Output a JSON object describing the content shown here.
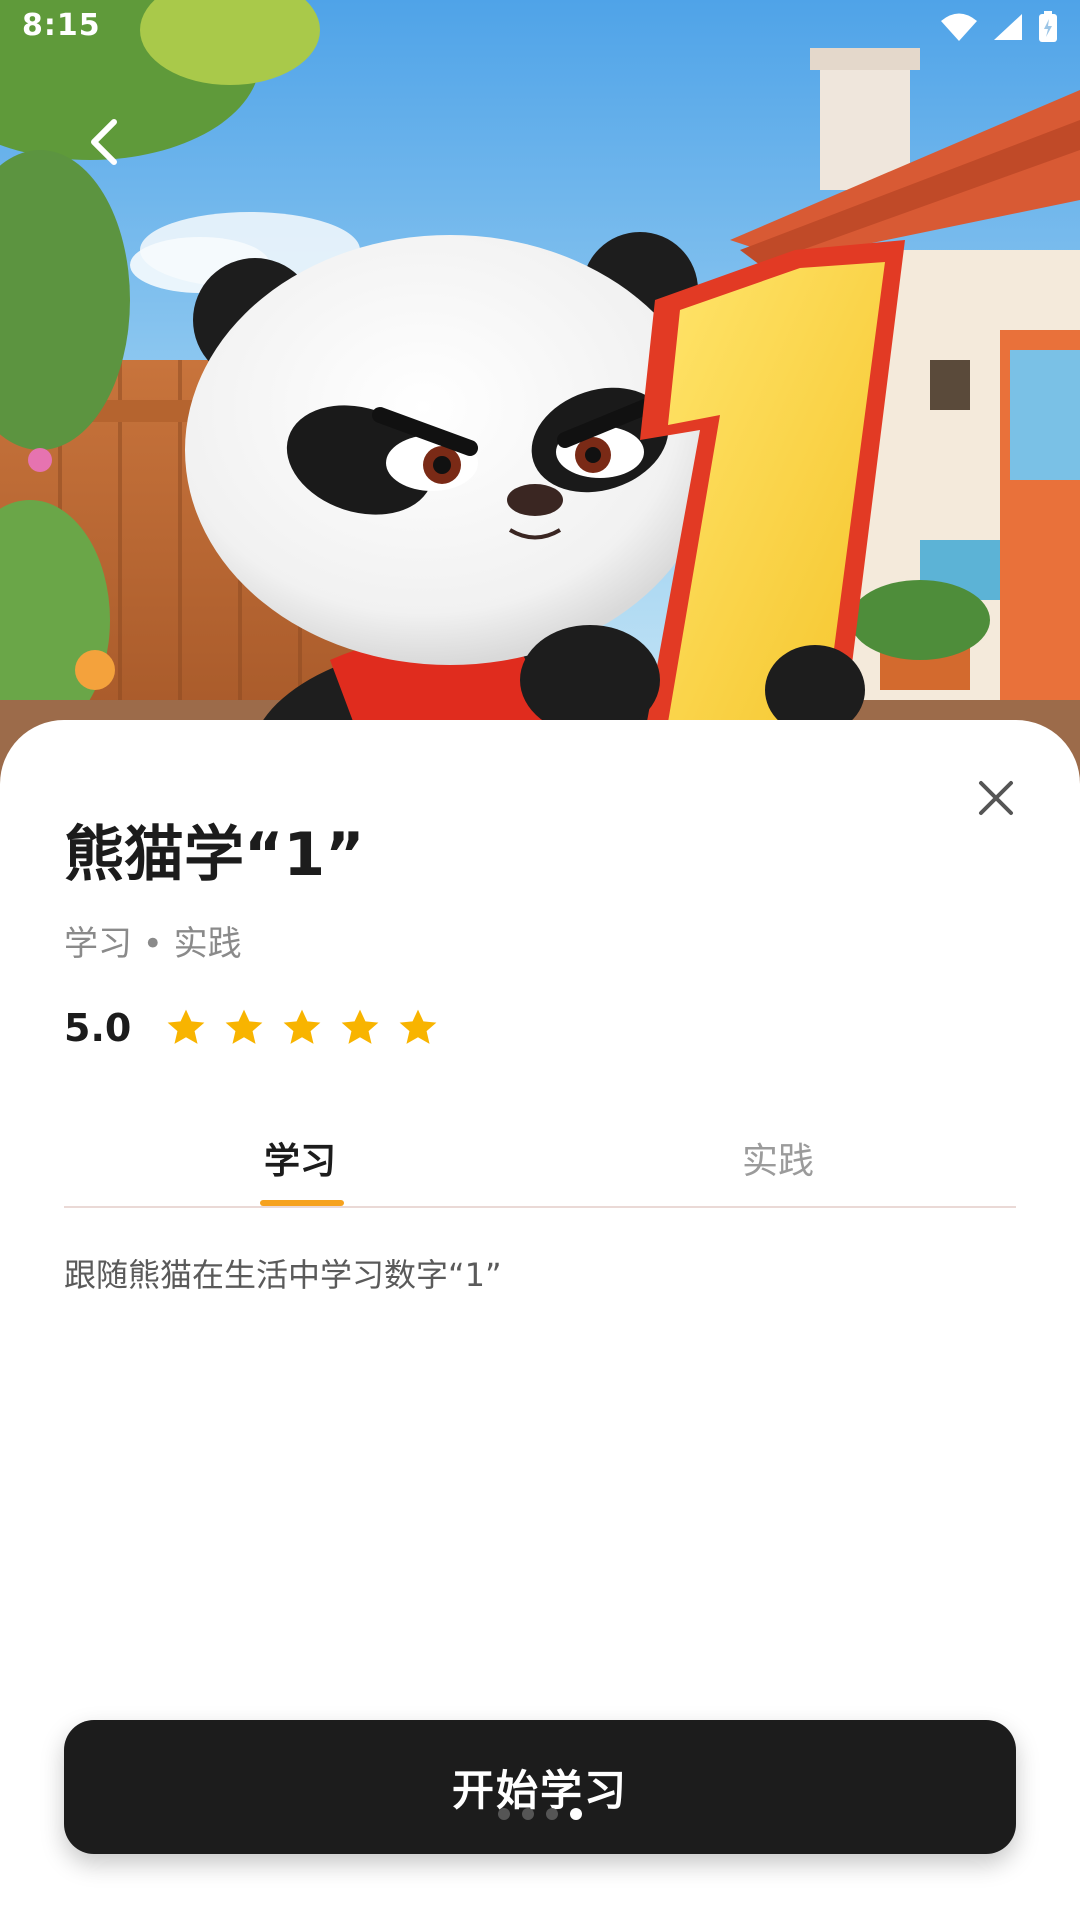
{
  "status_bar": {
    "time": "8:15",
    "icons": [
      "wifi-icon",
      "cellular-signal-icon",
      "battery-charging-icon"
    ]
  },
  "hero": {
    "image": "panda-holding-number-one-illustration"
  },
  "nav": {
    "back_icon": "back-arrow-icon",
    "close_icon": "close-icon"
  },
  "lesson": {
    "title": "熊猫学“1”",
    "subtitle": "学习 • 实践",
    "rating": "5.0",
    "stars_filled": 5,
    "stars_total": 5,
    "star_color": "#F8B400"
  },
  "tabs": [
    {
      "label": "学习",
      "active": true
    },
    {
      "label": "实践",
      "active": false
    }
  ],
  "tab_indicator_color": "#F6A21E",
  "description": "跟随熊猫在生活中学习数字“1”",
  "start_button": {
    "label": "开始学习"
  },
  "page_indicator": {
    "count": 4,
    "active_index": 3
  }
}
